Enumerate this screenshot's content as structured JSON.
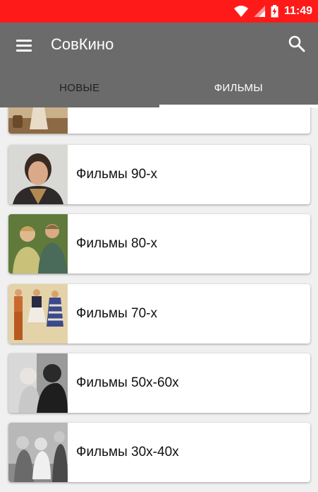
{
  "status": {
    "time": "11:49"
  },
  "app": {
    "title": "СовКино"
  },
  "tabs": [
    {
      "label": "НОВЫЕ",
      "active": false
    },
    {
      "label": "ФИЛЬМЫ",
      "active": true
    }
  ],
  "categories": [
    {
      "label": ""
    },
    {
      "label": "Фильмы 90-х"
    },
    {
      "label": "Фильмы 80-х"
    },
    {
      "label": "Фильмы 70-х"
    },
    {
      "label": "Фильмы 50х-60х"
    },
    {
      "label": "Фильмы 30х-40х"
    }
  ],
  "colors": {
    "status_bar": "#ff1a1a",
    "app_bar": "#6b6b6b"
  }
}
